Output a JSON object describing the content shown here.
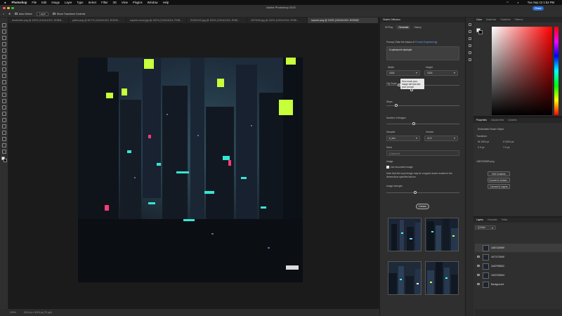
{
  "menubar": {
    "app": "Photoshop",
    "items": [
      "File",
      "Edit",
      "Image",
      "Layer",
      "Type",
      "Select",
      "Filter",
      "3D",
      "View",
      "Plugins",
      "Window",
      "Help"
    ],
    "clock": "Tue Sep 13 1:54 PM"
  },
  "title": "Adobe Photoshop 2022",
  "share_label": "Share",
  "options": {
    "auto_select": "Auto-Select:",
    "layer_value": "Layer",
    "transform": "Show Transform Controls"
  },
  "tabs": [
    "bookmark.png @ 100% (1024x1024, RGB/8...",
    "patrol.png @ 66.7% (1024x1024, RGB/8...",
    "square-cloud.jpg @ 100% (1024x1024, RGB...",
    "92420143.jpg @ 100% (1024x1024, RGB/...",
    "1873040.jpg @ 100% (1024x1024, RGB/...",
    "square.png @ 100% (1024x1024, RGB/8)*"
  ],
  "status": {
    "zoom": "100%",
    "doc": "1024 px x 1024 px (72 ppi)"
  },
  "ai": {
    "title": "Stable Diffusion",
    "tabs": [
      "SDPlay",
      "Generate",
      "History"
    ],
    "prompt_hint": "Prompt (Take the basics of",
    "prompt_link": "Prompt Engineering",
    "prompt_value": "A cyberpunk dystopia",
    "width_label": "Width",
    "width_value": "1024",
    "height_label": "Height",
    "height_value": "1024",
    "cfg_label": "Cfg Scale",
    "tooltip": "How much your image will look like your prompt",
    "steps_label": "Steps",
    "num_label": "Number of images",
    "sampler_label": "Sampler",
    "sampler_value": "k_lms",
    "engine_label": "Version",
    "engine_value": "v1.5",
    "seed_label": "Seed",
    "seed_placeholder": "(Optional)",
    "image_label": "Image",
    "use_doc_label": "Use document image",
    "note": "Note that the input image may be cropped and/or scaled to the dimensions specified above.",
    "strength_label": "Image strength",
    "create_label": "Dream"
  },
  "color_tabs": [
    "Color",
    "Swatches",
    "Gradients",
    "Patterns"
  ],
  "props": {
    "tabs": [
      "Properties",
      "Adjustments",
      "Libraries"
    ],
    "kind": "Embedded Smart Object",
    "transform": "Transform",
    "w": "W 1024 px",
    "h": "H 1024 px",
    "x": "X 0 px",
    "y": "Y 0 px",
    "file": "1687318989.png",
    "buttons": [
      "Edit Contents",
      "Convert to Linked...",
      "Convert to Layers"
    ]
  },
  "layers": {
    "tabs": [
      "Layers",
      "Channels",
      "Paths"
    ],
    "kind": "Q Kind",
    "items": [
      "1687318989",
      "1677473069",
      "1640798832",
      "1637033843",
      "Background"
    ]
  },
  "colors": {
    "accent": "#2a6fd6",
    "panel": "#2f2f2f"
  }
}
